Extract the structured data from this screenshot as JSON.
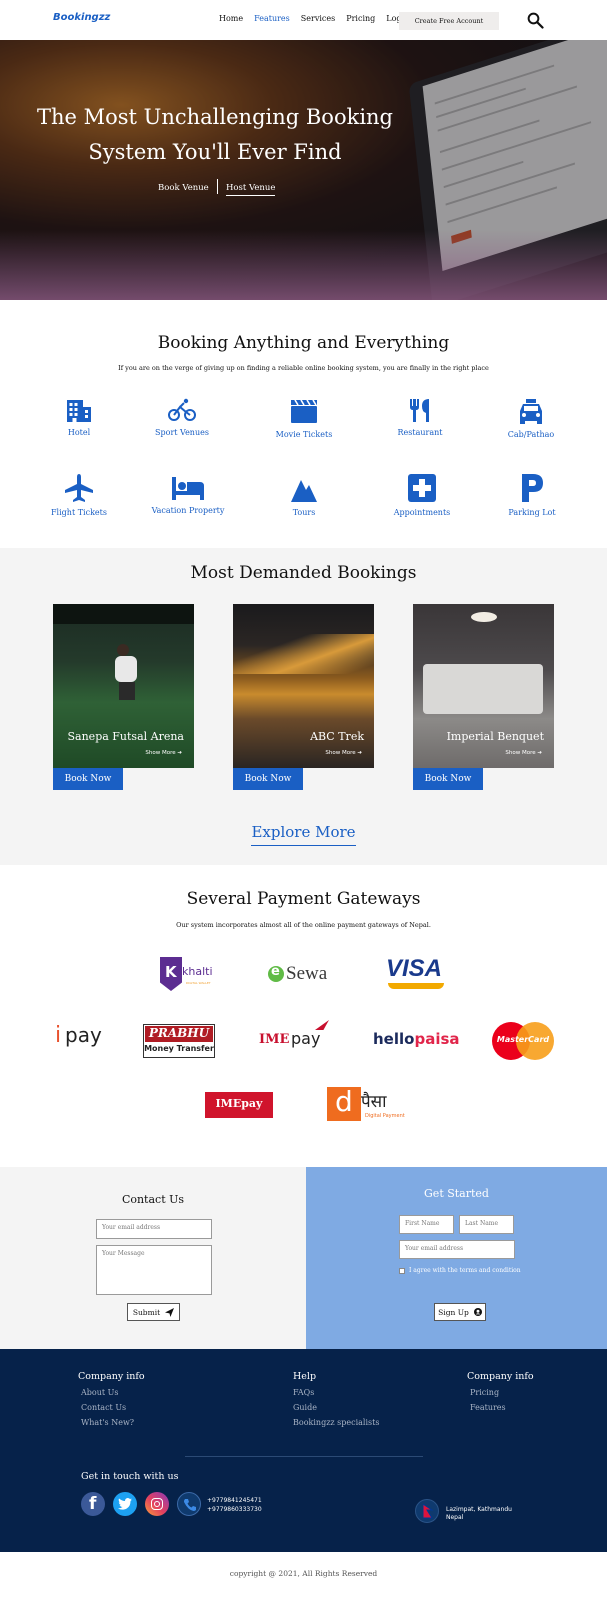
{
  "brand": {
    "logo": "Bookingzz",
    "accent": "#1a5fc4"
  },
  "nav": {
    "links": [
      "Home",
      "Features",
      "Services",
      "Pricing",
      "Login"
    ],
    "active": "Features",
    "cta": "Create Free Account",
    "search_icon": "search-icon"
  },
  "hero": {
    "title_line1": "The Most Unchallenging Booking",
    "title_line2": "System You'll Ever Find",
    "link_book": "Book Venue",
    "link_host": "Host Venue"
  },
  "booking": {
    "title": "Booking Anything and Everything",
    "subtitle": "If you are on the verge of giving up on finding a reliable online booking system, you are finally in the right place",
    "categories": [
      {
        "label": "Hotel",
        "icon": "hotel-icon"
      },
      {
        "label": "Sport Venues",
        "icon": "bicycle-icon"
      },
      {
        "label": "Movie Tickets",
        "icon": "clapperboard-icon"
      },
      {
        "label": "Restaurant",
        "icon": "utensils-icon"
      },
      {
        "label": "Cab/Pathao",
        "icon": "taxi-icon"
      },
      {
        "label": "Flight Tickets",
        "icon": "airplane-icon"
      },
      {
        "label": "Vacation Property",
        "icon": "bed-icon"
      },
      {
        "label": "Tours",
        "icon": "mountain-icon"
      },
      {
        "label": "Appointments",
        "icon": "medical-cross-icon"
      },
      {
        "label": "Parking Lot",
        "icon": "parking-icon"
      }
    ]
  },
  "demanded": {
    "title": "Most Demanded Bookings",
    "cards": [
      {
        "title": "Sanepa Futsal Arena",
        "more": "Show More",
        "button": "Book Now"
      },
      {
        "title": "ABC  Trek",
        "more": "Show More",
        "button": "Book Now"
      },
      {
        "title": "Imperial Benquet",
        "more": "Show More",
        "button": "Book Now"
      }
    ],
    "explore": "Explore More"
  },
  "payments": {
    "title": "Several Payment Gateways",
    "subtitle": "Our system incorporates almost all of the online payment gateways of Nepal.",
    "logos": {
      "khalti": "khalti",
      "khalti_sub": "DIGITAL WALLET",
      "khalti_k": "K",
      "esewa_e": "e",
      "esewa": "Sewa",
      "visa": "VISA",
      "ipay_i": "i",
      "ipay": "pay",
      "prabhu_top": "PRABHU",
      "prabhu_bottom": "Money Transfer",
      "imepay_ime": "IME",
      "imepay_pay": "pay",
      "hellopaisa_hello": "hello",
      "hellopaisa_paisa": "paisa",
      "mastercard": "MasterCard",
      "imepay2": "IMEpay",
      "dpaisa_d": "d",
      "dpaisa": "पैसा",
      "dpaisa_sub": "Digital Payment"
    }
  },
  "contact": {
    "title": "Contact Us",
    "email_placeholder": "Your email address",
    "message_placeholder": "Your Message",
    "submit": "Submit"
  },
  "getstarted": {
    "title": "Get Started",
    "first_name": "First Name",
    "last_name": "Last Name",
    "email_placeholder": "Your email address",
    "terms": "I agree with the terms and condition",
    "signup": "Sign Up"
  },
  "footer": {
    "col1": {
      "title": "Company info",
      "links": [
        "About Us",
        "Contact Us",
        "What's New?"
      ]
    },
    "col2": {
      "title": "Help",
      "links": [
        "FAQs",
        "Guide",
        "Bookingzz specialists"
      ]
    },
    "col3": {
      "title": "Company info",
      "links": [
        "Pricing",
        "Features"
      ]
    },
    "touch_title": "Get in touch with us",
    "phone1": "+9779841245471",
    "phone2": "+9779860333730",
    "address_line1": "Lazimpat, Kathmandu",
    "address_line2": "Nepal"
  },
  "copyright": "copyright @ 2021, All Rights Reserved"
}
